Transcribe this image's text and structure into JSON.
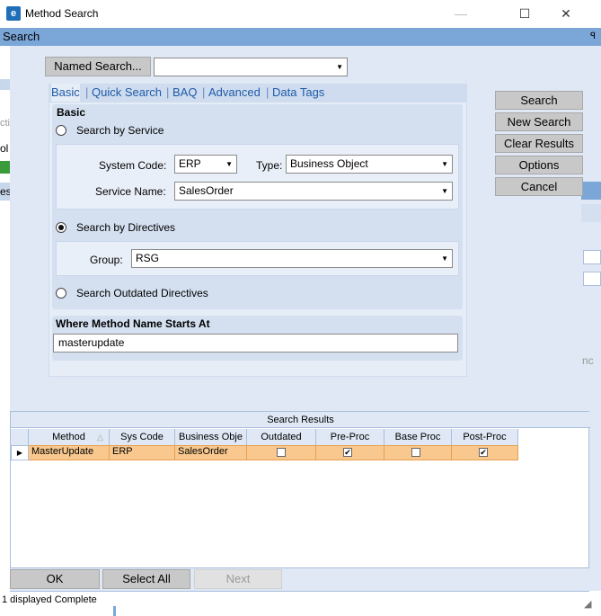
{
  "window": {
    "title": "Method Search",
    "min": "—",
    "max": "☐",
    "close": "✕"
  },
  "app_icon": "e-logo-icon",
  "header": {
    "label": "Search",
    "pin": "ꟼ"
  },
  "named_search": {
    "label": "Named Search...",
    "value": ""
  },
  "tabs": [
    "Basic",
    "Quick Search",
    "BAQ",
    "Advanced",
    "Data Tags"
  ],
  "basic": {
    "title": "Basic",
    "search_by_service": "Search by Service",
    "system_code_label": "System Code:",
    "system_code_value": "ERP",
    "type_label": "Type:",
    "type_value": "Business Object",
    "service_name_label": "Service Name:",
    "service_name_value": "SalesOrder",
    "search_by_directives": "Search by Directives",
    "group_label": "Group:",
    "group_value": "RSG",
    "search_outdated": "Search Outdated Directives",
    "where_label": "Where Method Name Starts At",
    "where_value": "masterupdate"
  },
  "side_buttons": {
    "search": "Search",
    "new_search": "New Search",
    "clear": "Clear Results",
    "options": "Options",
    "cancel": "Cancel"
  },
  "results": {
    "title": "Search Results",
    "columns": [
      "Method",
      "Sys Code",
      "Business Obje",
      "Outdated",
      "Pre-Proc",
      "Base Proc",
      "Post-Proc"
    ],
    "rows": [
      {
        "method": "MasterUpdate",
        "sys_code": "ERP",
        "business_object": "SalesOrder",
        "outdated": false,
        "pre_proc": true,
        "base_proc": false,
        "post_proc": true
      }
    ]
  },
  "bottom_buttons": {
    "ok": "OK",
    "select_all": "Select All",
    "next": "Next"
  },
  "status": "1 displayed Complete",
  "background_fragments": [
    "cti",
    "ol",
    "es",
    "nc"
  ]
}
